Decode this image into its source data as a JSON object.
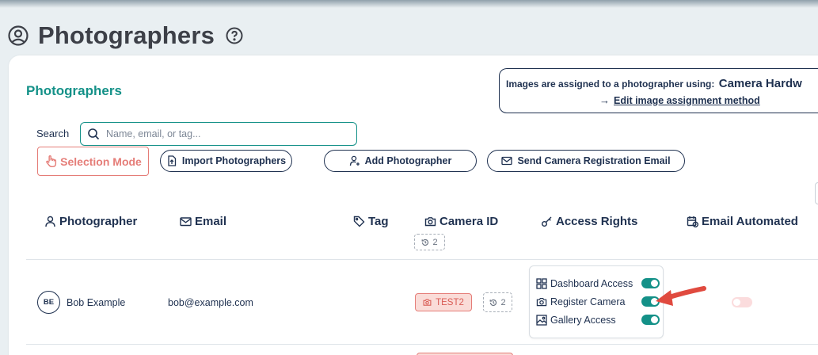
{
  "page": {
    "title": "Photographers",
    "icons": [
      "user-circle-icon",
      "help-circle-icon"
    ]
  },
  "card": {
    "title": "Photographers",
    "assignment": {
      "prefix": "Images are assigned to a photographer using:",
      "method": "Camera Hardw",
      "link": "Edit image assignment method",
      "arrow": "→"
    },
    "search": {
      "label": "Search",
      "placeholder": "Name, email, or tag...",
      "value": ""
    },
    "buttons": {
      "selection_mode": "Selection Mode",
      "import": "Import Photographers",
      "add": "Add Photographer",
      "send_email": "Send Camera Registration Email"
    },
    "columns": {
      "photographer": "Photographer",
      "email": "Email",
      "tag": "Tag",
      "camera_id": "Camera ID",
      "access_rights": "Access Rights",
      "email_automated": "Email Automated"
    },
    "camera_count_badge": "2",
    "rows": [
      {
        "initials": "BE",
        "name": "Bob Example",
        "email": "bob@example.com",
        "camera_tag": "TEST2",
        "history_count": "2",
        "access": [
          {
            "label": "Dashboard Access",
            "enabled": true
          },
          {
            "label": "Register Camera",
            "enabled": true
          },
          {
            "label": "Gallery Access",
            "enabled": true
          }
        ],
        "email_automated": false
      }
    ]
  },
  "colors": {
    "primary": "#1f3150",
    "accent": "#149188",
    "danger": "#e57d78",
    "tag_bg": "#fadcd8",
    "annotation_arrow": "#e04a3f"
  }
}
